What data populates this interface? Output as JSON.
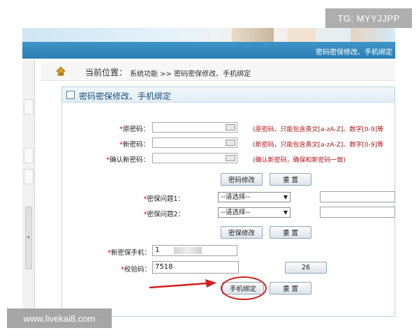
{
  "watermarks": {
    "top": "TG: MYYJJPP",
    "bottom": "www.livekai8.com"
  },
  "navbar": {
    "text": "密码密保修改、手机绑定"
  },
  "breadcrumb": {
    "label": "当前位置：",
    "path": "系统功能 >> 密码密保修改、手机绑定"
  },
  "panel": {
    "title": "密码密保修改、手机绑定"
  },
  "password_section": {
    "old_label": "原密码：",
    "new_label": "新密码：",
    "confirm_label": "确认新密码：",
    "old_hint": "(原密码，只能包含英文[a-zA-Z]、数字[0-9]等",
    "new_hint": "(新密码，只能包含英文[a-zA-Z]、数字[0-9]等",
    "confirm_hint": "(确认新密码，确保和新密码一致)",
    "modify_button": "密码修改",
    "reset_button": "重 置"
  },
  "security_section": {
    "q1_label": "密保问题1：",
    "q2_label": "密保问题2：",
    "q1_selected": "--请选择--",
    "q2_selected": "--请选择--",
    "modify_button": "密保修改",
    "reset_button": "重 置"
  },
  "phone_section": {
    "phone_label": "新密保手机：",
    "phone_value": "1",
    "code_label": "校验码：",
    "code_value": "7518",
    "captcha_text": "26",
    "bind_button": "手机绑定",
    "reset_button": "重 置"
  },
  "colors": {
    "navbar": "#2c7fb3",
    "hint": "#b0161b",
    "annotation": "#d11e1e"
  }
}
